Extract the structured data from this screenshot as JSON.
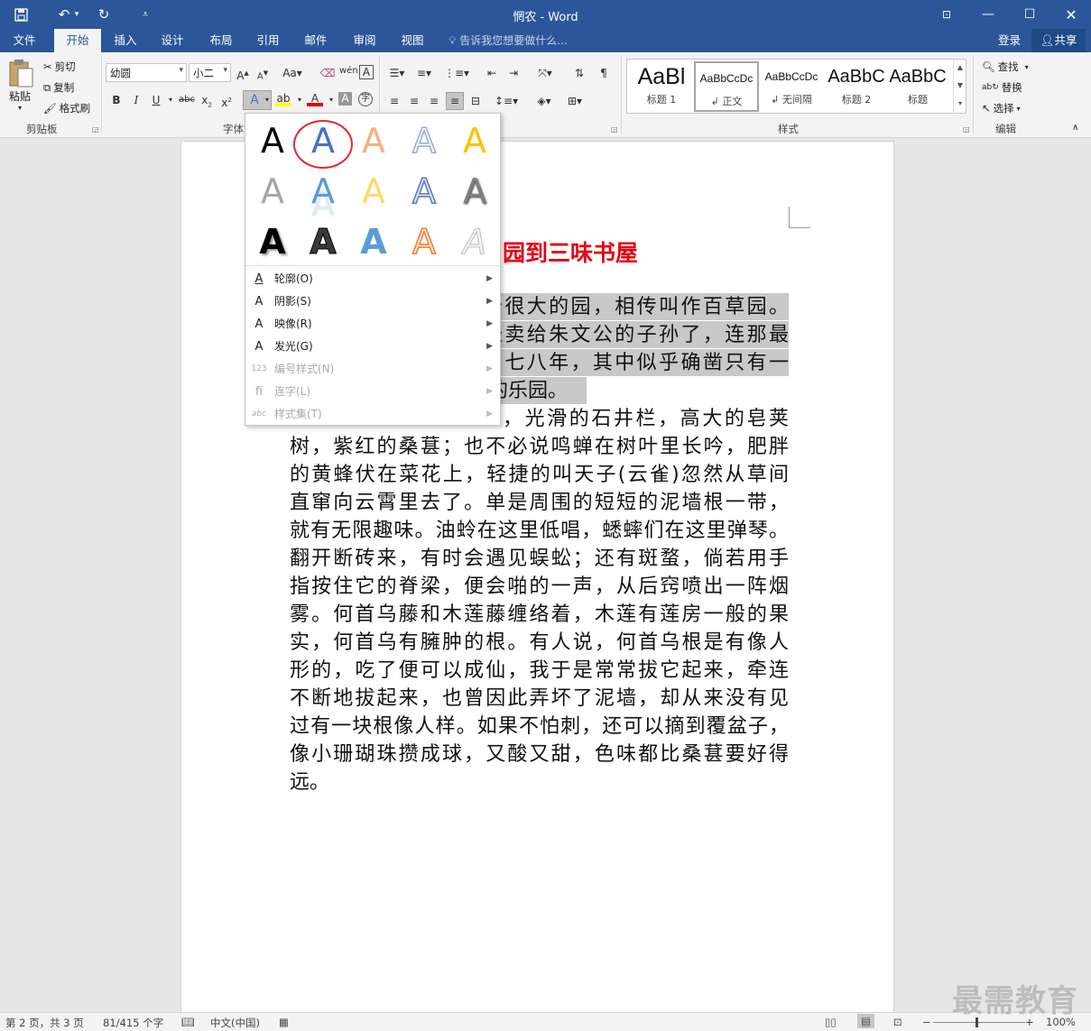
{
  "app": {
    "title": "惘农 - Word"
  },
  "quick_access": {
    "save_icon": "save-icon",
    "undo_icon": "undo-icon",
    "redo_icon": "redo-icon",
    "customize_icon": "customize-icon"
  },
  "window_controls": {
    "restore_ribbon": "ribbon-display-icon",
    "minimize": "minimize-icon",
    "maximize": "maximize-icon",
    "close": "close-icon"
  },
  "tabs": [
    "文件",
    "开始",
    "插入",
    "设计",
    "布局",
    "引用",
    "邮件",
    "审阅",
    "视图"
  ],
  "active_tab": "开始",
  "tell_me": "告诉我您想要做什么...",
  "account": {
    "login": "登录",
    "share": "共享"
  },
  "clipboard": {
    "paste": "粘贴",
    "cut": "剪切",
    "copy": "复制",
    "format_painter": "格式刷",
    "group": "剪贴板"
  },
  "font": {
    "name": "幼圆",
    "size": "小二",
    "group": "字体"
  },
  "paragraph": {
    "group": "段落"
  },
  "styles": {
    "group": "样式",
    "items": [
      {
        "sample": "AaBl",
        "name": "标题 1"
      },
      {
        "sample": "AaBbCcDc",
        "name": "↲ 正文"
      },
      {
        "sample": "AaBbCcDc",
        "name": "↲ 无间隔"
      },
      {
        "sample": "AaBbC",
        "name": "标题 2"
      },
      {
        "sample": "AaBbC",
        "name": "标题"
      }
    ]
  },
  "editing": {
    "find": "查找",
    "replace": "替换",
    "select": "选择",
    "group": "编辑"
  },
  "effects_menu": {
    "items": [
      {
        "label": "轮廓(O)",
        "enabled": true
      },
      {
        "label": "阴影(S)",
        "enabled": true
      },
      {
        "label": "映像(R)",
        "enabled": true
      },
      {
        "label": "发光(G)",
        "enabled": true
      },
      {
        "label": "编号样式(N)",
        "enabled": false
      },
      {
        "label": "连字(L)",
        "enabled": false
      },
      {
        "label": "样式集(T)",
        "enabled": false
      }
    ],
    "glyph": "A"
  },
  "document": {
    "heading_visible": "园到三味书屋",
    "lines": [
      "个很大的园，相传叫作百草园。",
      "经卖给朱文公的子孙了，连那最",
      "了七八年，其中似乎确凿只有一",
      "的乐园。",
      "，光滑的石井栏，高大的皂荚",
      "树，紫红的桑葚；也不必说鸣蝉在树叶里长吟，肥胖",
      "的黄蜂伏在菜花上，轻捷的叫天子(云雀)忽然从草间",
      "直窜向云霄里去了。单是周围的短短的泥墙根一带，",
      "就有无限趣味。油蛉在这里低唱，蟋蟀们在这里弹琴。",
      "翻开断砖来，有时会遇见蜈蚣；还有斑蝥，倘若用手",
      "指按住它的脊梁，便会啪的一声，从后窍喷出一阵烟",
      "雾。何首乌藤和木莲藤缠络着，木莲有莲房一般的果",
      "实，何首乌有臃肿的根。有人说，何首乌根是有像人",
      "形的，吃了便可以成仙，我于是常常拔它起来，牵连",
      "不断地拔起来，也曾因此弄坏了泥墙，却从来没有见",
      "过有一块根像人样。如果不怕刺，还可以摘到覆盆子，",
      "像小珊瑚珠攒成球，又酸又甜，色味都比桑葚要好得",
      "远。"
    ]
  },
  "status": {
    "page": "第 2 页，共 3 页",
    "words": "81/415 个字",
    "language": "中文(中国)",
    "zoom": "100%"
  },
  "watermark": "最需教育",
  "colors": {
    "word_blue": "#2b579a",
    "heading_red": "#e60012",
    "circle_red": "#e8252b"
  }
}
